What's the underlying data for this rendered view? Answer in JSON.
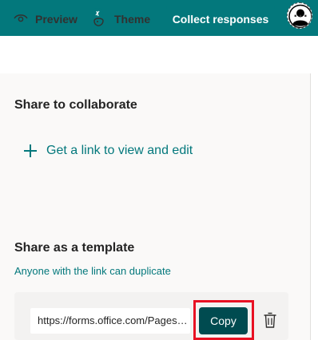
{
  "header": {
    "help_label": "?",
    "help_icon": "question-mark-icon",
    "avatar_icon": "user-avatar-icon",
    "brand_color": "#03787c"
  },
  "toolbar": {
    "preview_label": "Preview",
    "preview_icon": "eye-icon",
    "theme_label": "Theme",
    "theme_icon": "paint-palette-icon",
    "collect_label": "Collect responses",
    "more_label": "···",
    "more_icon": "more-options-icon"
  },
  "collaborate": {
    "heading": "Share to collaborate",
    "link_label": "Get a link to view and edit",
    "link_icon": "plus-icon"
  },
  "template": {
    "heading": "Share as a template",
    "subtext": "Anyone with the link can duplicate",
    "url_value": "https://forms.office.com/Pages/ShareFormPage.aspx",
    "copy_label": "Copy",
    "delete_icon": "trash-icon",
    "highlight_color": "#e81123"
  }
}
